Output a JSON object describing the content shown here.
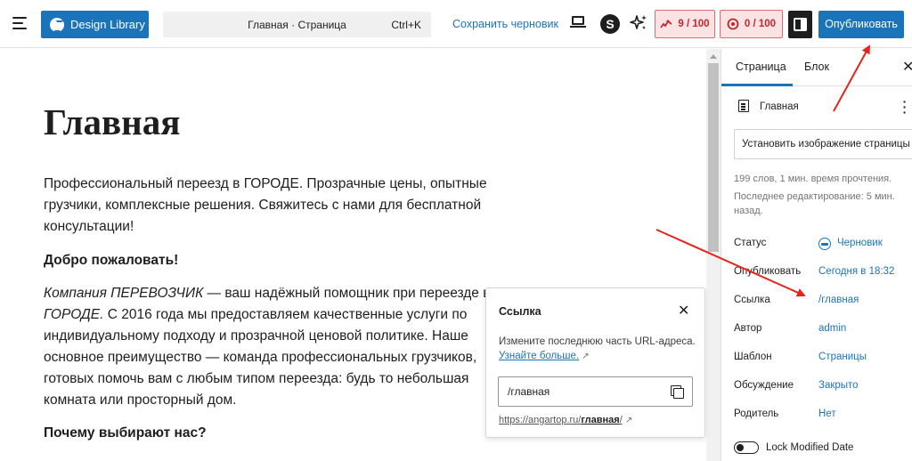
{
  "toolbar": {
    "design_library_label": "Design Library",
    "command_title": "Главная · Страница",
    "command_shortcut": "Ctrl+K",
    "save_draft_label": "Сохранить черновик",
    "s_icon_glyph": "S",
    "seo_score": "9 / 100",
    "readability_score": "0 / 100",
    "publish_label": "Опубликовать"
  },
  "editor": {
    "title": "Главная",
    "paragraph1": "Профессиональный переезд в ГОРОДЕ. Прозрачные цены, опытные грузчики, комплексные решения. Свяжитесь с нами для бесплатной консультации!",
    "heading_welcome": "Добро пожаловать!",
    "p2_company": "Компания ПЕРЕВОЗЧИК",
    "p2_part1": " — ваш надёжный помощник при переезде в ",
    "p2_city": "ГОРОДЕ.",
    "p2_part2": " С 2016 года мы предоставляем качественные услуги по индивидуальному подходу и прозрачной ценовой политике. Наше основное преимущество — команда профессиональных грузчиков, готовых помочь вам с любым типом переезда: будь то небольшая комната или просторный дом.",
    "heading_why": "Почему выбирают нас?"
  },
  "link_popover": {
    "title": "Ссылка",
    "help_text": "Измените последнюю часть URL-адреса.",
    "learn_more": "Узнайте больше.",
    "slug_value": "/главная",
    "url_base": "https://angartop.ru/",
    "url_slug": "главная",
    "url_tail": "/"
  },
  "sidebar": {
    "tab_page": "Страница",
    "tab_block": "Блок",
    "page_name": "Главная",
    "featured_image": "Установить изображение страницы",
    "meta_words": "199 слов, 1 мин. время прочтения.",
    "meta_edited": "Последнее редактирование: 5 мин. назад.",
    "rows": [
      {
        "label": "Статус",
        "value": "Черновик"
      },
      {
        "label": "Опубликовать",
        "value": "Сегодня в 18:32"
      },
      {
        "label": "Ссылка",
        "value": "/главная"
      },
      {
        "label": "Автор",
        "value": "admin"
      },
      {
        "label": "Шаблон",
        "value": "Страницы"
      },
      {
        "label": "Обсуждение",
        "value": "Закрыто"
      },
      {
        "label": "Родитель",
        "value": "Нет"
      }
    ],
    "lock_modified_label": "Lock Modified Date"
  },
  "colors": {
    "accent": "#1b74ba",
    "score_bg": "#fbe3e4",
    "score_text": "#c0272d",
    "annotation_arrow": "#e8231b"
  }
}
